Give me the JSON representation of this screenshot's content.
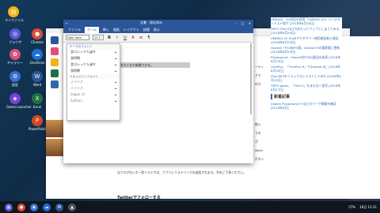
{
  "desktop": {
    "icons": [
      {
        "label": "マイファイル",
        "color": "#f2b21a",
        "glyph": "▤"
      },
      {
        "label": "ブラウザ",
        "color": "#5a56d6",
        "glyph": "◎"
      },
      {
        "label": "Chrome",
        "color": "#dd4b39",
        "glyph": "●"
      },
      {
        "label": "ギャラリー",
        "color": "#e04f7b",
        "glyph": "✿"
      },
      {
        "label": "OneDrive",
        "color": "#1e6fd9",
        "glyph": "☁"
      },
      {
        "label": "設定",
        "color": "#3a6fd0",
        "glyph": "⚙"
      },
      {
        "label": "Word",
        "color": "#2b579a",
        "glyph": "W"
      },
      {
        "label": "Game Launcher",
        "color": "#7b3fd8",
        "glyph": "◈"
      },
      {
        "label": "Excel",
        "color": "#1e7145",
        "glyph": "X"
      },
      {
        "label": "PowerPoint",
        "color": "#d24726",
        "glyph": "P"
      }
    ]
  },
  "word": {
    "title": "文書 - 保存済み",
    "tabs": [
      "ファイル",
      "ホーム",
      "挿入",
      "描画",
      "レイアウト",
      "校閲",
      "表示"
    ],
    "active_tab": "ホーム",
    "font_name": "Noto Sans",
    "font_size": "10.5",
    "selected_text": "選択したテキストなり新規できる。",
    "ribbon_icons": [
      "B",
      "I",
      "U",
      "A",
      "≡",
      "¶"
    ]
  },
  "font_dropdown": {
    "header_theme": "テーマのフォント",
    "header_doc": "ドキュメントフォント",
    "items": [
      {
        "label": "游ゴシック Light",
        "gray": false
      },
      {
        "label": "游明朝",
        "gray": false
      },
      {
        "label": "游ゴシック Light",
        "gray": false
      },
      {
        "label": "游明朝",
        "gray": false
      },
      {
        "label": "メイリオ",
        "gray": true
      },
      {
        "label": "メイリオ",
        "gray": true
      },
      {
        "label": "Segoe UI",
        "gray": true
      },
      {
        "label": "Sylfaen",
        "gray": true
      }
    ]
  },
  "blog": {
    "items": [
      "UMIDIGI、5G対応を採用『UMIDIGI A3』ハンズオンテスト紹介 [2018年8月28日]",
      "OPPO Find Xなど8台もっとウェブとしまとてみる [2018年8月29日]",
      "UMIDIGI Z2 Proのアクセサリー使用感比較と検証 [2018年8月24日]",
      "Huawei「P20ⅢEFS版」Android 9の通常版に更新 [2018年8月20日]",
      "Playground、Xiaomi向けFAQ製品を発表 [2018年8月23日]",
      "OnePlus、「OnePlus 6」でAndroid 9に [2018年8月20日]",
      "Vivo NEXをリラックスしテストしてみた [2018年8月20日]",
      "OPPO Japan、「Find X」をまもなく発売 [2018年8月17日]",
      "Xiaomi Pocophone F1などのリーク情報を確認 [2018年8月]"
    ],
    "section_title": "新着記事",
    "mid_texts": [
      "ーティ",
      "ドで",
      "の力",
      "挑入",
      "うの",
      "が",
      "Word",
      "ボタン"
    ],
    "bottom_caption": "当ブログのレポ一覧リストでは、アプリにリストリンクの送信されます。予めご了承ください。",
    "bottom_bold": "Twitterでフォローする"
  },
  "taskbar": {
    "clock": "18日 12:31",
    "battery": "57%",
    "icons": [
      "▦",
      "●",
      "◉",
      "☁",
      "W",
      "▲"
    ]
  }
}
